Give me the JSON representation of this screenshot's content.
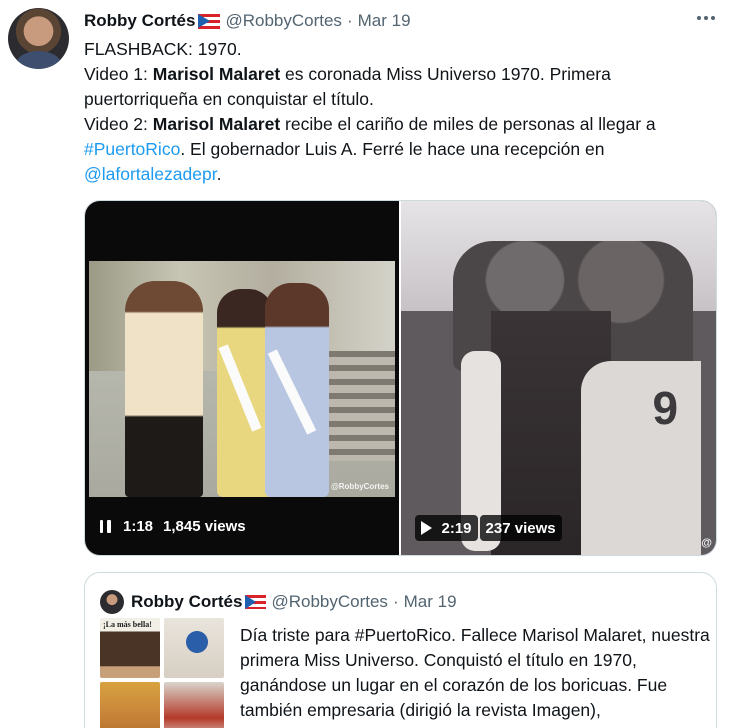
{
  "tweet": {
    "author_name": "Robby Cortés",
    "handle": "@RobbyCortes",
    "separator": "·",
    "date": "Mar 19",
    "text": {
      "line1": "FLASHBACK: 1970.",
      "v1_prefix": "Video 1: ",
      "v1_name": "Marisol Malaret",
      "v1_rest": " es coronada Miss Universo 1970. Primera puertorriqueña en conquistar el título.",
      "v2_prefix": "Video 2: ",
      "v2_name": "Marisol Malaret",
      "v2_rest": " recibe el cariño de miles de personas al llegar a ",
      "hashtag": "#PuertoRico",
      "v2_rest2": ". El gobernador Luis A. Ferré le hace una recepción en ",
      "mention": "@lafortalezadepr",
      "v2_end": "."
    }
  },
  "video1": {
    "time": "1:18",
    "views": "1,845 views",
    "watermark": "@RobbyCortes",
    "state": "playing"
  },
  "video2": {
    "time": "2:19",
    "views": "237 views",
    "corner_mark": "@",
    "frame_digit": "9",
    "state": "paused"
  },
  "quoted_tweet": {
    "author_name": "Robby Cortés",
    "handle": "@RobbyCortes",
    "separator": "·",
    "date": "Mar 19",
    "thumb_text": "¡La más bella!",
    "text": "Día triste para #PuertoRico. Fallece Marisol Malaret, nuestra primera Miss Universo. Conquistó el título en 1970, ganándose un lugar en el corazón de los boricuas. Fue también empresaria (dirigió la revista Imagen), comunicadora, entre otras facetas #QEPD"
  },
  "icons": {
    "more": "more-horizontal-icon",
    "flag": "puerto-rico-flag-icon",
    "pause": "pause-icon",
    "play": "play-icon"
  },
  "colors": {
    "link": "#1d9bf0",
    "secondary_text": "#536471",
    "border": "#cfd9de"
  }
}
